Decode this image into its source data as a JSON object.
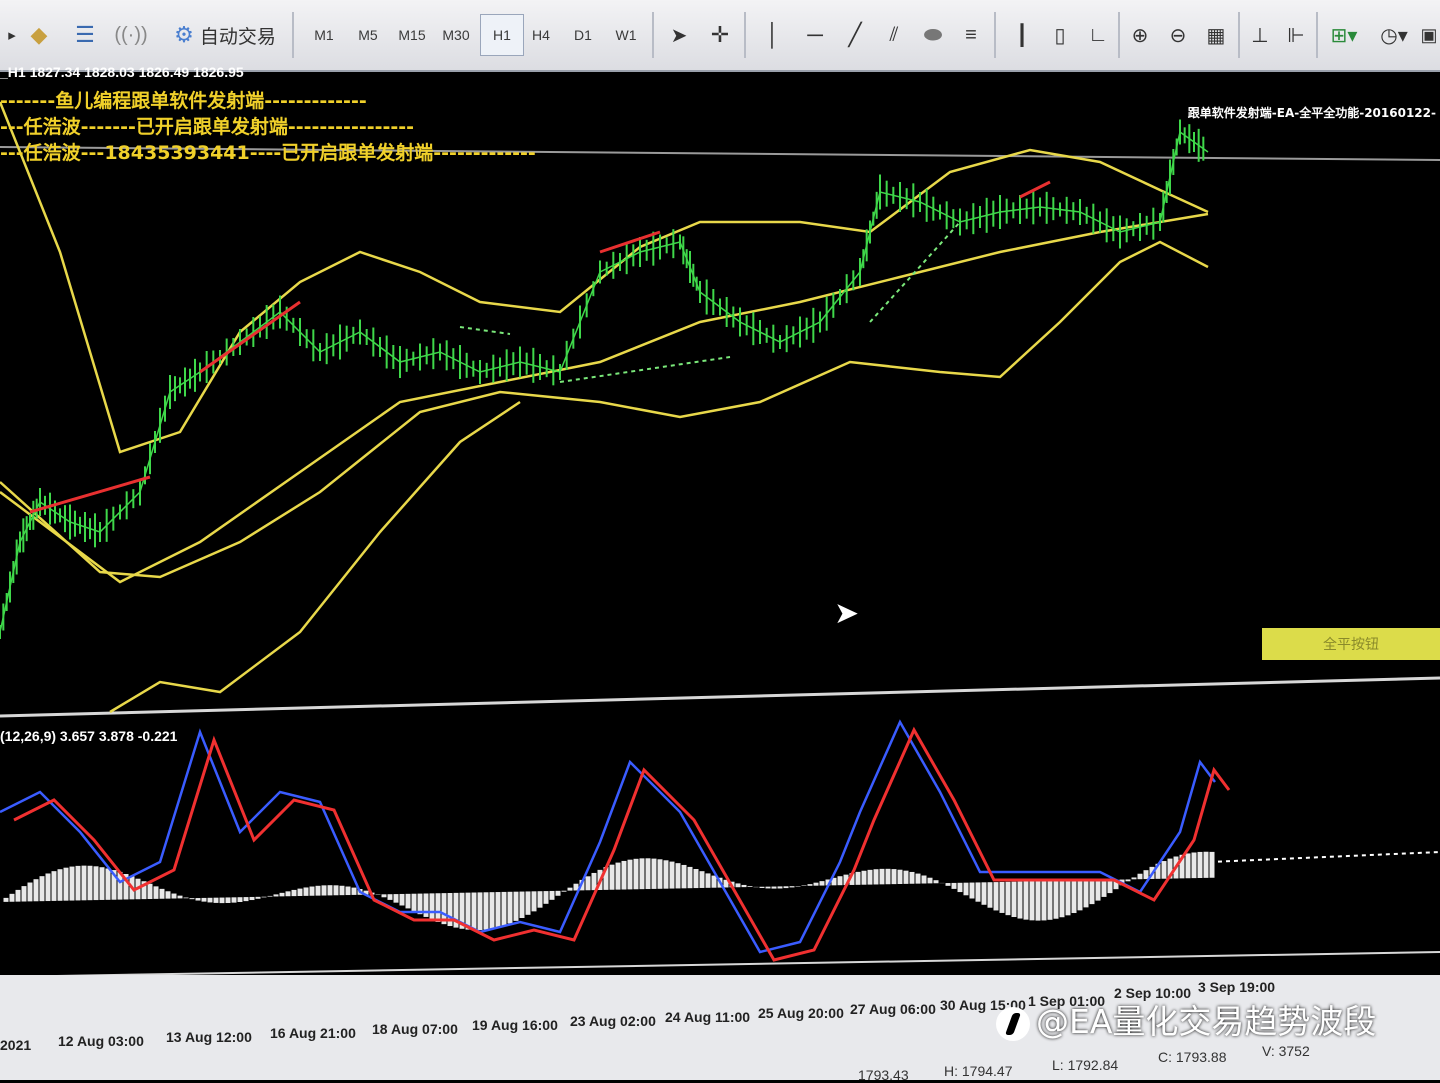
{
  "toolbar": {
    "auto_trade_label": "自动交易",
    "timeframes": [
      "M1",
      "M5",
      "M15",
      "M30",
      "H1",
      "H4",
      "D1",
      "W1"
    ],
    "active_timeframe": "H1",
    "icons": [
      "cursor-icon",
      "crosshair-icon",
      "vertical-line-icon",
      "horizontal-line-icon",
      "trendline-icon",
      "channel-icon",
      "ellipse-icon",
      "fibonacci-icon",
      "bar-chart-icon",
      "candle-chart-icon",
      "line-chart-icon",
      "zoom-in-icon",
      "zoom-out-icon",
      "tile-windows-icon",
      "chart-shift-icon",
      "autoscroll-icon",
      "indicators-icon",
      "periods-icon"
    ]
  },
  "chart": {
    "symbol_ohlc": "_H1  1827.34 1828.03 1826.49 1826.95",
    "line1": "-------鱼儿编程跟单软件发射端-------------",
    "line2": "---任浩波-------已开启跟单发射端----------------",
    "line3": "---任浩波---18435393441----已开启跟单发射端-------------",
    "ea_label": "跟单软件发射端-EA-全平全功能-20160122-",
    "close_all_button": "全平按钮",
    "macd_label": "(12,26,9) 3.657 3.878 -0.221"
  },
  "time_axis": {
    "labels": [
      "2021",
      "12 Aug 03:00",
      "13 Aug 12:00",
      "16 Aug 21:00",
      "18 Aug 07:00",
      "19 Aug 16:00",
      "23 Aug 02:00",
      "24 Aug 11:00",
      "25 Aug 20:00",
      "27 Aug 06:00",
      "30 Aug 15:00",
      "1 Sep 01:00",
      "2 Sep 10:00",
      "3 Sep 19:00"
    ]
  },
  "status_bar": {
    "values": [
      "1793.43",
      "H: 1794.47",
      "L: 1792.84",
      "C: 1793.88",
      "V: 3752"
    ]
  },
  "watermark": "@EA量化交易趋势波段",
  "colors": {
    "price_bars": "#3fd84a",
    "bollinger": "#e8d84a",
    "macd_main": "#f03030",
    "macd_signal": "#3a5cff",
    "histogram": "#e8e8e8",
    "background": "#000000"
  }
}
